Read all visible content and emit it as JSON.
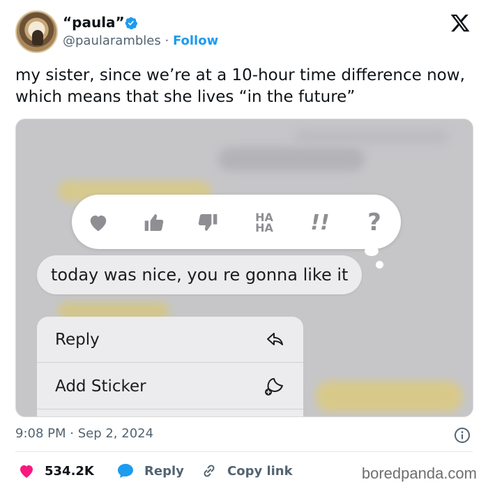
{
  "author": {
    "display_name": "“paula”",
    "handle": "@paularambles",
    "separator": "·",
    "follow_label": "Follow"
  },
  "tweet": {
    "text": "my sister, since we’re at a 10-hour time difference now, which means that she lives “in the future”"
  },
  "media": {
    "message_text": "today was nice, you re gonna like it",
    "reactions": [
      "heart-icon",
      "thumbs-up-icon",
      "thumbs-down-icon",
      "haha-icon",
      "exclamation-icon",
      "question-icon"
    ],
    "haha_label_top": "HA",
    "haha_label_bottom": "HA",
    "exclaim_label": "!!",
    "question_label": "?",
    "menu": [
      {
        "label": "Reply",
        "icon": "reply-arrow-icon"
      },
      {
        "label": "Add Sticker",
        "icon": "add-sticker-icon"
      }
    ]
  },
  "meta": {
    "timestamp": "9:08 PM · Sep 2, 2024"
  },
  "actions": {
    "likes": "534.2K",
    "reply_label": "Reply",
    "copy_label": "Copy link"
  },
  "watermark": "boredpanda.com",
  "colors": {
    "accent": "#1d9bf0",
    "like": "#f91880",
    "text_secondary": "#536471"
  }
}
